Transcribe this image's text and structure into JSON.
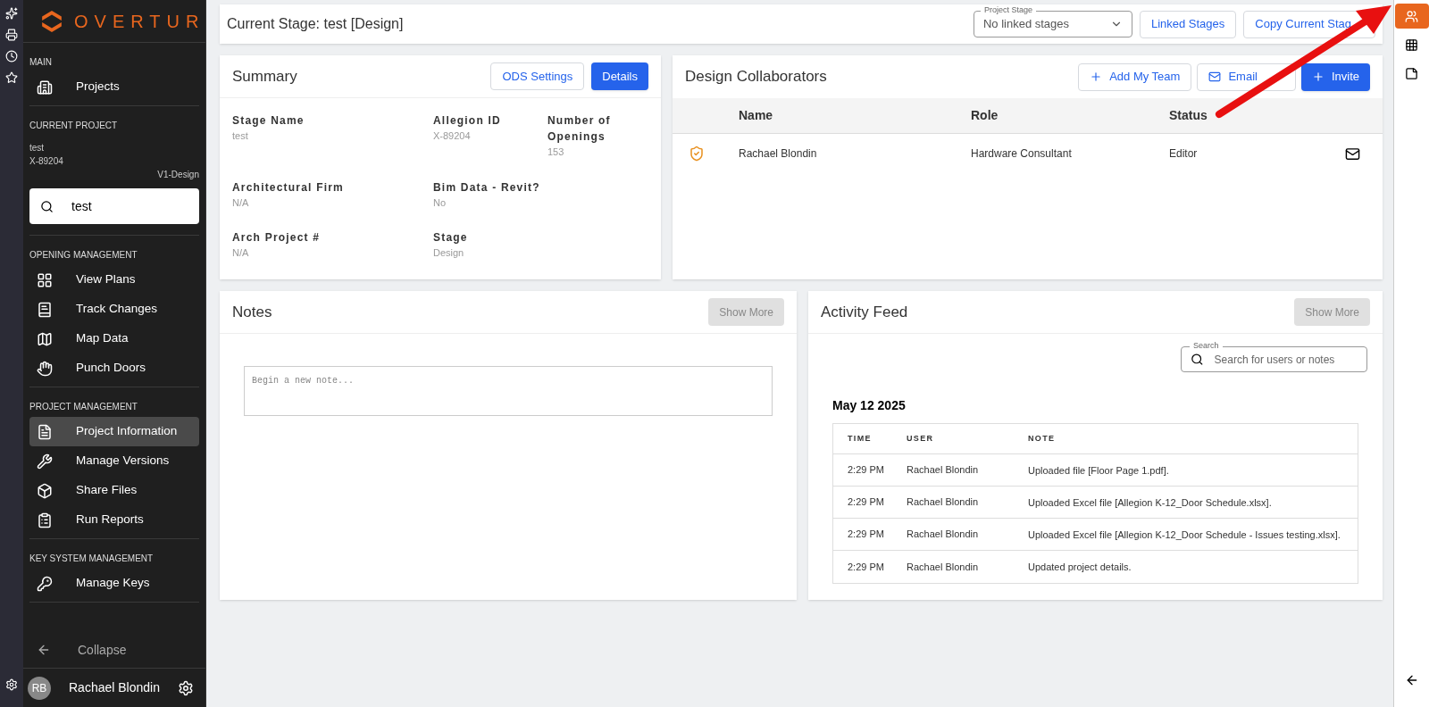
{
  "sidebar": {
    "logo": "OVERTUR",
    "sections": [
      {
        "title": "MAIN",
        "items": [
          {
            "label": "Projects",
            "selected": false
          }
        ]
      },
      {
        "title": "CURRENT PROJECT",
        "kind": "project",
        "project_name": "test",
        "project_id": "X-89204",
        "version": "V1-Design",
        "search": {
          "value": "test"
        }
      },
      {
        "title": "OPENING MANAGEMENT",
        "items": [
          {
            "label": "View Plans",
            "selected": false
          },
          {
            "label": "Track Changes",
            "selected": false
          },
          {
            "label": "Map Data",
            "selected": false
          },
          {
            "label": "Punch Doors",
            "selected": false
          }
        ]
      },
      {
        "title": "PROJECT MANAGEMENT",
        "items": [
          {
            "label": "Project Information",
            "selected": true
          },
          {
            "label": "Manage Versions",
            "selected": false
          },
          {
            "label": "Share Files",
            "selected": false
          },
          {
            "label": "Run Reports",
            "selected": false
          }
        ]
      },
      {
        "title": "KEY SYSTEM MANAGEMENT",
        "items": [
          {
            "label": "Manage Keys",
            "selected": false
          }
        ]
      }
    ],
    "collapse": "Collapse",
    "user": {
      "initials": "RB",
      "name": "Rachael Blondin"
    }
  },
  "header": {
    "title": "Current Stage: test [Design]",
    "stage_select": {
      "label": "Project Stage",
      "value": "No linked stages"
    },
    "buttons": [
      "Linked Stages",
      "Copy Current Stag"
    ]
  },
  "summary": {
    "title": "Summary",
    "buttons": [
      {
        "label": "ODS Settings",
        "kind": "outline"
      },
      {
        "label": "Details",
        "kind": "primary"
      }
    ],
    "field_rows": [
      [
        {
          "label": "Stage Name",
          "value": "test"
        },
        {
          "label": "Allegion ID",
          "value": "X-89204"
        },
        {
          "label": "Number of Openings",
          "value": "153"
        }
      ],
      [
        {
          "label": "Architectural Firm",
          "value": "N/A"
        },
        {
          "label": "Bim Data - Revit?",
          "value": "No"
        }
      ],
      [
        {
          "label": "Arch Project #",
          "value": "N/A"
        },
        {
          "label": "Stage",
          "value": "Design"
        }
      ]
    ]
  },
  "collaborators": {
    "title": "Design Collaborators",
    "buttons": [
      {
        "label": "Add My Team",
        "kind": "outline"
      },
      {
        "label": "Email",
        "kind": "outline"
      },
      {
        "label": "Invite",
        "kind": "primary"
      }
    ],
    "columns": [
      "Name",
      "Role",
      "Status"
    ],
    "rows": [
      {
        "name": "Rachael Blondin",
        "role": "Hardware Consultant",
        "status": "Editor"
      }
    ]
  },
  "notes": {
    "title": "Notes",
    "button": "Show More",
    "placeholder": "Begin a new note..."
  },
  "activity": {
    "title": "Activity Feed",
    "button": "Show More",
    "search": {
      "label": "Search",
      "placeholder": "Search for users or notes"
    },
    "date": "May 12 2025",
    "columns": [
      "TIME",
      "USER",
      "NOTE"
    ],
    "rows": [
      {
        "time": "2:29 PM",
        "user": "Rachael Blondin",
        "note": "Uploaded file [Floor Page 1.pdf]."
      },
      {
        "time": "2:29 PM",
        "user": "Rachael Blondin",
        "note": "Uploaded Excel file [Allegion K-12_Door Schedule.xlsx]."
      },
      {
        "time": "2:29 PM",
        "user": "Rachael Blondin",
        "note": "Uploaded Excel file [Allegion K-12_Door Schedule - Issues testing.xlsx]."
      },
      {
        "time": "2:29 PM",
        "user": "Rachael Blondin",
        "note": "Updated project details."
      }
    ]
  },
  "right_rail": [
    {
      "selected": true
    },
    {
      "selected": false
    },
    {
      "selected": false
    }
  ]
}
